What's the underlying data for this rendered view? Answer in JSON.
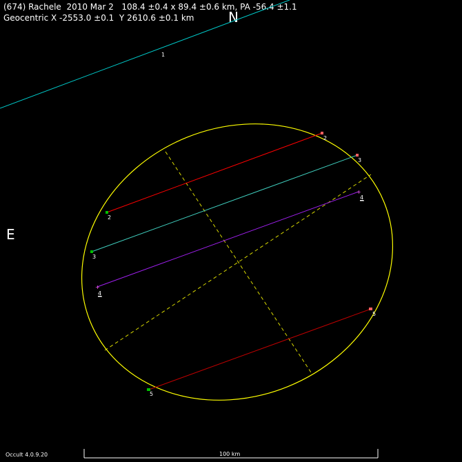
{
  "header": {
    "line1": "(674) Rachele  2010 Mar 2   108.4 ±0.4 x 89.4 ±0.6 km, PA -56.4 ±1.1",
    "line2": "Geocentric X -2553.0 ±0.1  Y 2610.6 ±0.1 km"
  },
  "compass": {
    "north": "N",
    "east": "E"
  },
  "footer": {
    "version": "Occult 4.0.9.20",
    "scale_label": "100 km"
  },
  "colors": {
    "ellipse": "#ffff00",
    "axes": "#ffff00",
    "background": "#000000",
    "text": "#ffffff"
  },
  "chords": [
    {
      "label": "1",
      "color": "#00c8c8",
      "underline": false
    },
    {
      "label": "2",
      "color": "#ff0000",
      "underline": false
    },
    {
      "label": "3",
      "color": "#40d0c0",
      "underline": false
    },
    {
      "label": "4",
      "color": "#a020f0",
      "underline": true
    },
    {
      "label": "5",
      "color": "#c00000",
      "underline": false
    }
  ]
}
